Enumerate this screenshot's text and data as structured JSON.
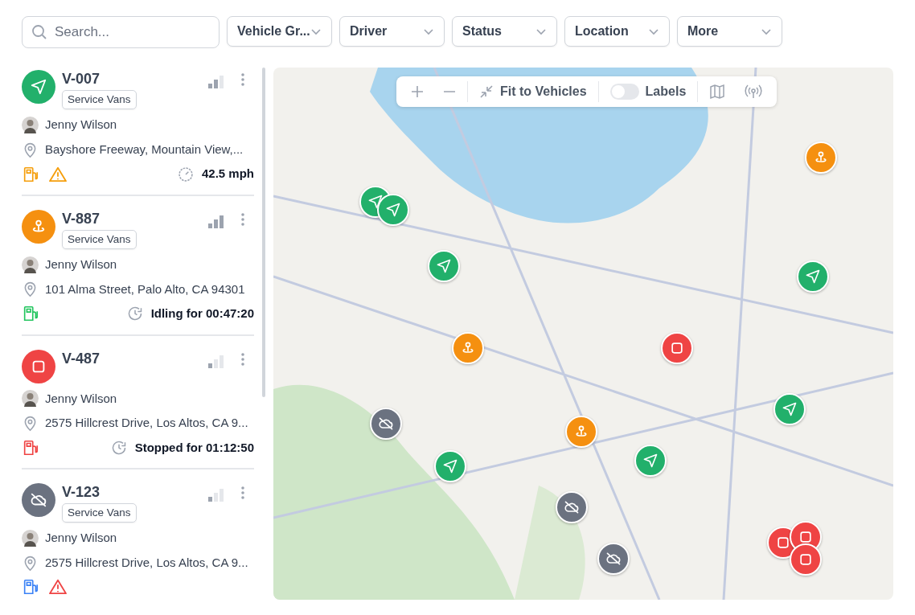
{
  "search": {
    "placeholder": "Search..."
  },
  "filters": [
    {
      "label": "Vehicle Gr..."
    },
    {
      "label": "Driver"
    },
    {
      "label": "Status"
    },
    {
      "label": "Location"
    },
    {
      "label": "More"
    }
  ],
  "vehicles": [
    {
      "id": "V-007",
      "kind": "moving",
      "group": "Service Vans",
      "signal": {
        "kind": "medium"
      },
      "driver": "Jenny Wilson",
      "address": "Bayshore Freeway, Mountain View,...",
      "fuel": {
        "color": "#f59e0b"
      },
      "alert": {
        "kind": "warning"
      },
      "status": {
        "kind": "speed",
        "text": "42.5 mph"
      }
    },
    {
      "id": "V-887",
      "kind": "idle",
      "group": "Service Vans",
      "signal": {
        "kind": "strong"
      },
      "driver": "Jenny Wilson",
      "address": "101 Alma Street, Palo Alto, CA 94301",
      "fuel": {
        "color": "#22c55e"
      },
      "status": {
        "kind": "time",
        "text": "Idling for 00:47:20"
      }
    },
    {
      "id": "V-487",
      "kind": "stopped",
      "signal": {
        "kind": "weak"
      },
      "driver": "Jenny Wilson",
      "address": "2575 Hillcrest Drive, Los Altos, CA 9...",
      "fuel": {
        "color": "#ef4444"
      },
      "status": {
        "kind": "time",
        "text": "Stopped for 01:12:50"
      }
    },
    {
      "id": "V-123",
      "kind": "offline",
      "group": "Service Vans",
      "signal": {
        "kind": "weak"
      },
      "driver": "Jenny Wilson",
      "address": "2575 Hillcrest Drive, Los Altos, CA 9...",
      "fuel": {
        "color": "#3b82f6"
      },
      "alert": {
        "kind": "critical"
      }
    }
  ],
  "map_toolbar": {
    "fit_label": "Fit to Vehicles",
    "labels_label": "Labels",
    "labels_on": false
  },
  "markers": [
    {
      "kind": "moving"
    },
    {
      "kind": "moving"
    },
    {
      "kind": "moving"
    },
    {
      "kind": "moving"
    },
    {
      "kind": "moving"
    },
    {
      "kind": "moving"
    },
    {
      "kind": "moving"
    },
    {
      "kind": "idle"
    },
    {
      "kind": "idle"
    },
    {
      "kind": "idle"
    },
    {
      "kind": "stopped"
    },
    {
      "kind": "stopped"
    },
    {
      "kind": "stopped"
    },
    {
      "kind": "stopped"
    },
    {
      "kind": "offline"
    },
    {
      "kind": "offline"
    },
    {
      "kind": "offline"
    }
  ]
}
